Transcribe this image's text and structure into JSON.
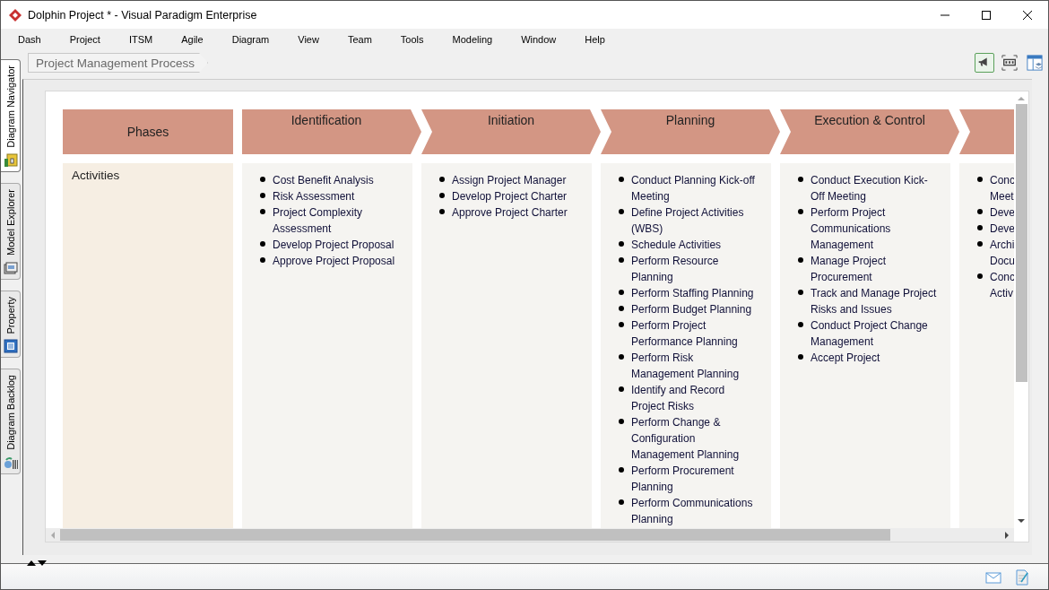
{
  "window": {
    "title": "Dolphin Project * - Visual Paradigm Enterprise"
  },
  "menu": [
    "Dash",
    "Project",
    "ITSM",
    "Agile",
    "Diagram",
    "View",
    "Team",
    "Tools",
    "Modeling",
    "Window",
    "Help"
  ],
  "side_tabs": [
    {
      "label": "Diagram Navigator",
      "kind": "navigator",
      "selected": true
    },
    {
      "label": "Model Explorer",
      "kind": "explorer",
      "selected": false
    },
    {
      "label": "Property",
      "kind": "property",
      "selected": false
    },
    {
      "label": "Diagram Backlog",
      "kind": "backlog",
      "selected": false
    }
  ],
  "breadcrumb": "Project Management Process",
  "toolbar": [
    {
      "kind": "megaphone",
      "selected": true
    },
    {
      "kind": "fit",
      "selected": false
    },
    {
      "kind": "layout",
      "selected": false
    }
  ],
  "diagram": {
    "columns": [
      {
        "kind": "box",
        "title": "Phases",
        "label": "Activities"
      },
      {
        "kind": "arrow-first",
        "title": "Identification",
        "items": [
          "Cost Benefit Analysis",
          "Risk Assessment",
          "Project Complexity\nAssessment",
          "Develop Project Proposal",
          "Approve Project Proposal"
        ]
      },
      {
        "kind": "arrow",
        "title": "Initiation",
        "items": [
          "Assign Project Manager",
          "Develop Project Charter",
          "Approve Project Charter"
        ]
      },
      {
        "kind": "arrow",
        "title": "Planning",
        "items": [
          "Conduct Planning Kick-off\nMeeting",
          "Define Project Activities\n(WBS)",
          "Schedule Activities",
          "Perform Resource\nPlanning",
          "Perform Staffing Planning",
          "Perform Budget Planning",
          "Perform Project\nPerformance Planning",
          "Perform Risk\nManagement Planning",
          "Identify and Record\nProject Risks",
          "Perform Change &\nConfiguration\nManagement Planning",
          "Perform Procurement\nPlanning",
          "Perform Communications\nPlanning"
        ]
      },
      {
        "kind": "arrow",
        "title": "Execution & Control",
        "items": [
          "Conduct Execution Kick-\nOff Meeting",
          "Perform Project\nCommunications\nManagement",
          "Manage Project\nProcurement",
          "Track and Manage Project\nRisks and Issues",
          "Conduct Project Change\nManagement",
          "Accept Project"
        ]
      },
      {
        "kind": "arrow",
        "items": [
          "Conc\nMeet",
          "Deve",
          "Deve",
          "Archi\nDocu",
          "Conc\nActiv"
        ]
      }
    ]
  }
}
